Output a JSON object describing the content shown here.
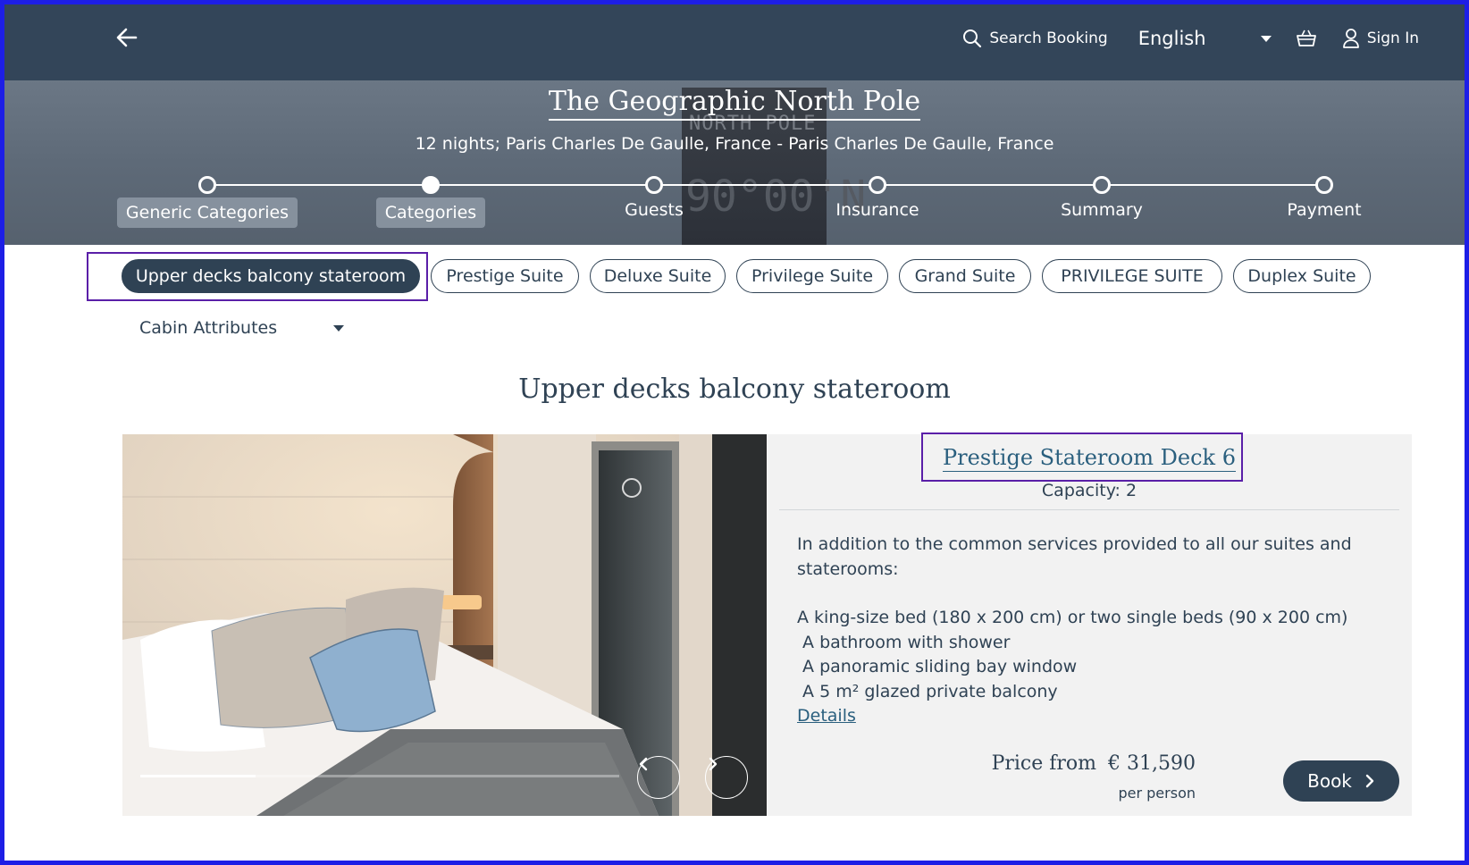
{
  "header": {
    "search_label": "Search Booking",
    "language": "English",
    "signin_label": "Sign In"
  },
  "hero": {
    "sign_line1": "NORTH POLE",
    "sign_line2": "90°00'N",
    "title": "The Geographic North Pole",
    "subtitle": "12 nights; Paris Charles De Gaulle, France - Paris Charles De Gaulle, France",
    "steps": [
      {
        "label": "Generic Categories",
        "state": "done"
      },
      {
        "label": "Categories",
        "state": "current"
      },
      {
        "label": "Guests",
        "state": "todo"
      },
      {
        "label": "Insurance",
        "state": "todo"
      },
      {
        "label": "Summary",
        "state": "todo"
      },
      {
        "label": "Payment",
        "state": "todo"
      }
    ]
  },
  "categories": {
    "pills": [
      {
        "label": "Upper decks balcony stateroom",
        "active": true
      },
      {
        "label": "Prestige Suite",
        "active": false
      },
      {
        "label": "Deluxe Suite",
        "active": false
      },
      {
        "label": "Privilege Suite",
        "active": false
      },
      {
        "label": "Grand Suite",
        "active": false
      },
      {
        "label": "PRIVILEGE SUITE",
        "active": false
      },
      {
        "label": "Duplex Suite",
        "active": false
      }
    ],
    "cabin_attributes_label": "Cabin Attributes"
  },
  "section_title": "Upper decks balcony stateroom",
  "gallery": {
    "progress": 0.24
  },
  "room": {
    "name": "Prestige Stateroom Deck 6",
    "capacity": "Capacity: 2",
    "intro": "In addition to the common services provided to all our suites and staterooms:",
    "features": [
      "A king-size bed (180 x 200 cm) or two single beds (90 x 200 cm)",
      " A bathroom with shower",
      " A panoramic sliding bay window",
      " A 5 m² glazed private balcony"
    ],
    "details_label": "Details",
    "price_from_label": "Price from",
    "price": "€ 31,590",
    "per_person": "per person",
    "book_label": "Book"
  },
  "colors": {
    "header_bg": "#334559",
    "accent": "#2f4254",
    "link": "#2a5f7e",
    "highlight_border": "#5a1fa8"
  }
}
